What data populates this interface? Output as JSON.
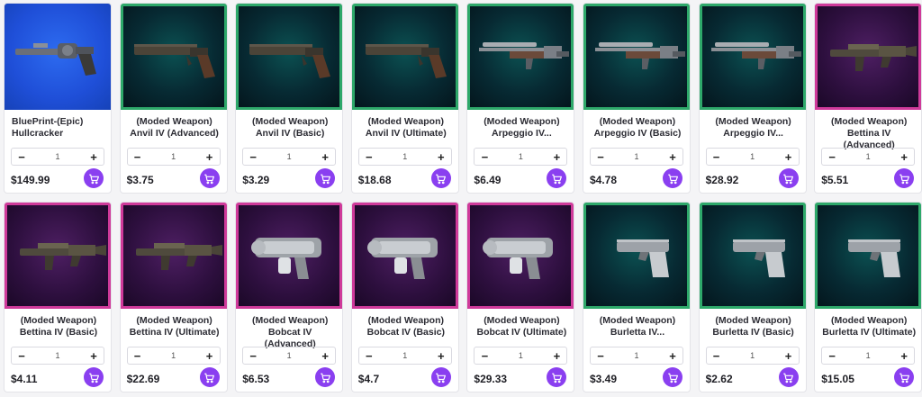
{
  "products": [
    {
      "theme": "blue",
      "gun": "revolver",
      "title": "BluePrint-(Epic)\nHullcracker",
      "align": "left",
      "qty": "1",
      "price": "$149.99"
    },
    {
      "theme": "green",
      "gun": "rifle",
      "title": "(Moded Weapon)\nAnvil IV (Advanced)",
      "qty": "1",
      "price": "$3.75"
    },
    {
      "theme": "green",
      "gun": "rifle",
      "title": "(Moded Weapon)\nAnvil IV (Basic)",
      "qty": "1",
      "price": "$3.29"
    },
    {
      "theme": "green",
      "gun": "rifle",
      "title": "(Moded Weapon)\nAnvil IV (Ultimate)",
      "qty": "1",
      "price": "$18.68"
    },
    {
      "theme": "green",
      "gun": "sniper",
      "title": "(Moded Weapon)\nArpeggio IV...",
      "qty": "1",
      "price": "$6.49"
    },
    {
      "theme": "green",
      "gun": "sniper",
      "title": "(Moded Weapon)\nArpeggio IV (Basic)",
      "qty": "1",
      "price": "$4.78"
    },
    {
      "theme": "green",
      "gun": "sniper",
      "title": "(Moded Weapon)\nArpeggio IV...",
      "qty": "1",
      "price": "$28.92"
    },
    {
      "theme": "purple",
      "gun": "smg",
      "title": "(Moded Weapon)\nBettina IV (Advanced)",
      "qty": "1",
      "price": "$5.51"
    },
    {
      "theme": "purple",
      "gun": "smg",
      "title": "(Moded Weapon)\nBettina IV (Basic)",
      "qty": "1",
      "price": "$4.11"
    },
    {
      "theme": "purple",
      "gun": "smg",
      "title": "(Moded Weapon)\nBettina IV (Ultimate)",
      "qty": "1",
      "price": "$22.69"
    },
    {
      "theme": "purple",
      "gun": "blaster",
      "title": "(Moded Weapon)\nBobcat IV (Advanced)",
      "qty": "1",
      "price": "$6.53"
    },
    {
      "theme": "purple",
      "gun": "blaster",
      "title": "(Moded Weapon)\nBobcat IV (Basic)",
      "qty": "1",
      "price": "$4.7"
    },
    {
      "theme": "purple",
      "gun": "blaster",
      "title": "(Moded Weapon)\nBobcat IV (Ultimate)",
      "qty": "1",
      "price": "$29.33"
    },
    {
      "theme": "green",
      "gun": "pistol",
      "title": "(Moded Weapon)\nBurletta IV...",
      "qty": "1",
      "price": "$3.49"
    },
    {
      "theme": "green",
      "gun": "pistol",
      "title": "(Moded Weapon)\nBurletta IV (Basic)",
      "qty": "1",
      "price": "$2.62"
    },
    {
      "theme": "green",
      "gun": "pistol",
      "title": "(Moded Weapon)\nBurletta IV (Ultimate)",
      "qty": "1",
      "price": "$15.05"
    }
  ],
  "labels": {
    "minus": "−",
    "plus": "+"
  },
  "colors": {
    "accent": "#8a3ff0",
    "green_frame": "#2ea86a",
    "purple_frame": "#cf3a9a",
    "blue_bg": "#1f4fd8"
  }
}
